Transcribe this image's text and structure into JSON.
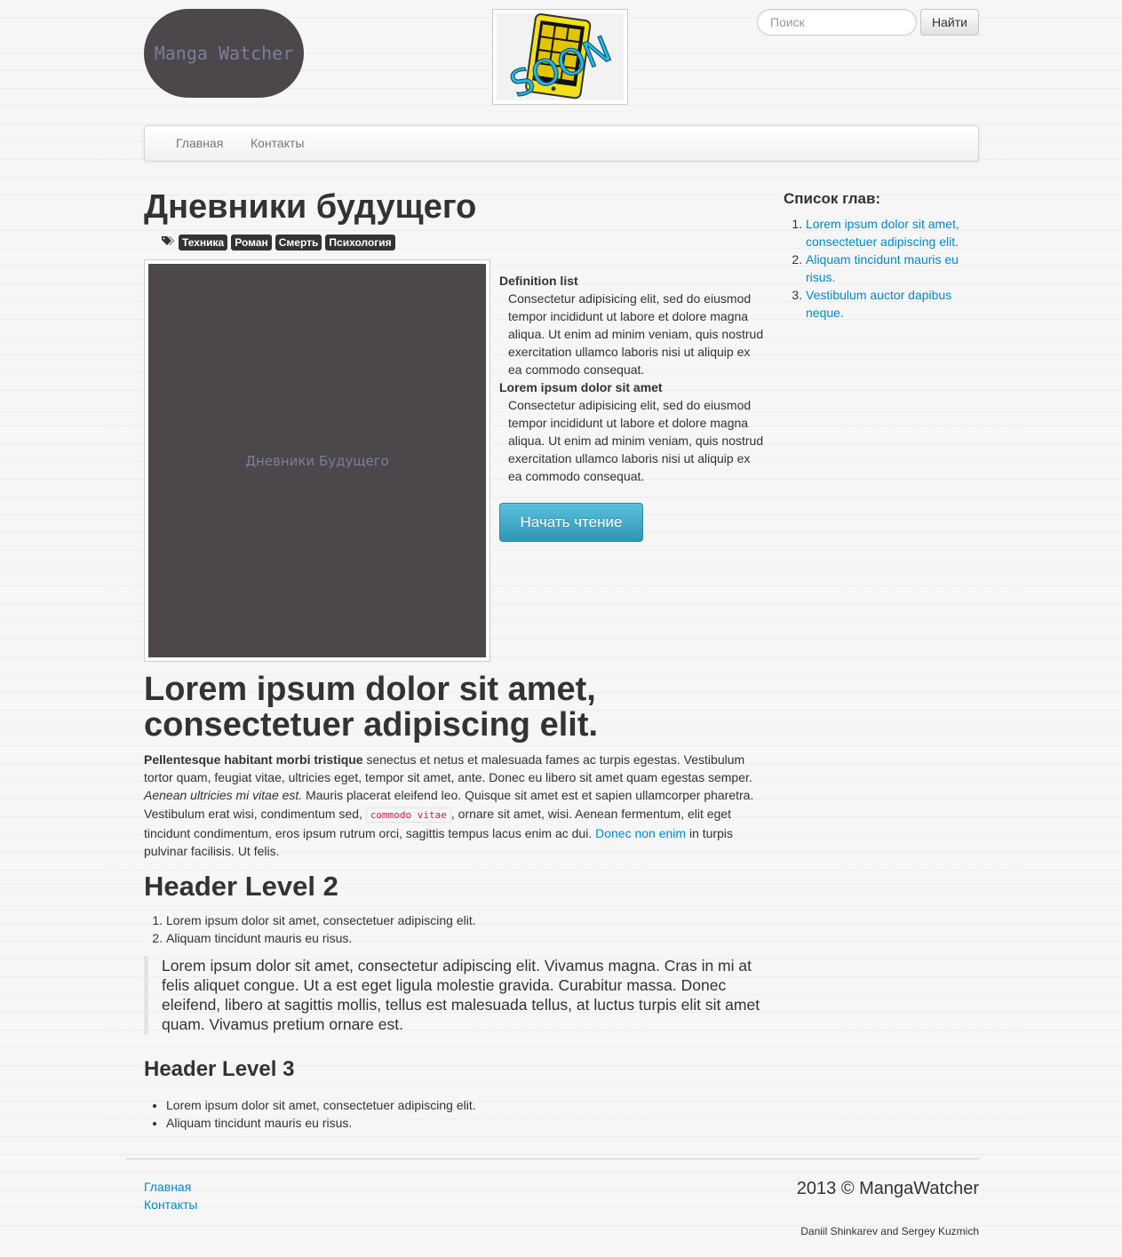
{
  "header": {
    "logo_text": "Manga Watcher",
    "ad_text": "SOON",
    "search": {
      "placeholder": "Поиск",
      "value": "",
      "button_label": "Найти"
    }
  },
  "nav": {
    "items": [
      "Главная",
      "Контакты"
    ]
  },
  "manga": {
    "title": "Дневники будущего",
    "tags": [
      "Техника",
      "Роман",
      "Смерть",
      "Психология"
    ],
    "cover_text": "Дневники Будущего",
    "definitions": [
      {
        "term": "Definition list",
        "description": "Consectetur adipisicing elit, sed do eiusmod tempor incididunt ut labore et dolore magna aliqua. Ut enim ad minim veniam, quis nostrud exercitation ullamco laboris nisi ut aliquip ex ea commodo consequat."
      },
      {
        "term": "Lorem ipsum dolor sit amet",
        "description": "Consectetur adipisicing elit, sed do eiusmod tempor incididunt ut labore et dolore magna aliqua. Ut enim ad minim veniam, quis nostrud exercitation ullamco laboris nisi ut aliquip ex ea commodo consequat."
      }
    ],
    "start_button": "Начать чтение"
  },
  "sidebar": {
    "title": "Список глав:",
    "chapters": [
      "Lorem ipsum dolor sit amet, consectetuer adipiscing elit.",
      "Aliquam tincidunt mauris eu risus.",
      "Vestibulum auctor dapibus neque."
    ]
  },
  "content": {
    "heading": "Lorem ipsum dolor sit amet, consectetuer adipiscing elit.",
    "paragraph": {
      "strong": "Pellentesque habitant morbi tristique",
      "text1": " senectus et netus et malesuada fames ac turpis egestas. Vestibulum tortor quam, feugiat vitae, ultricies eget, tempor sit amet, ante. Donec eu libero sit amet quam egestas semper. ",
      "em": "Aenean ultricies mi vitae est.",
      "text2": " Mauris placerat eleifend leo. Quisque sit amet est et sapien ullamcorper pharetra. Vestibulum erat wisi, condimentum sed, ",
      "code": "commodo vitae",
      "text3": ", ornare sit amet, wisi. Aenean fermentum, elit eget tincidunt condimentum, eros ipsum rutrum orci, sagittis tempus lacus enim ac dui. ",
      "link": "Donec non enim",
      "text4": " in turpis pulvinar facilisis. Ut felis."
    },
    "h2": "Header Level 2",
    "ordered": [
      "Lorem ipsum dolor sit amet, consectetuer adipiscing elit.",
      "Aliquam tincidunt mauris eu risus."
    ],
    "blockquote": "Lorem ipsum dolor sit amet, consectetur adipiscing elit. Vivamus magna. Cras in mi at felis aliquet congue. Ut a est eget ligula molestie gravida. Curabitur massa. Donec eleifend, libero at sagittis mollis, tellus est malesuada tellus, at luctus turpis elit sit amet quam. Vivamus pretium ornare est.",
    "h3": "Header Level 3",
    "unordered": [
      "Lorem ipsum dolor sit amet, consectetuer adipiscing elit.",
      "Aliquam tincidunt mauris eu risus."
    ]
  },
  "footer": {
    "links": [
      "Главная",
      "Контакты"
    ],
    "copyright": "2013 © MangaWatcher",
    "credits": "Daniil Shinkarev and Sergey Kuzmich"
  },
  "colors": {
    "link": "#0088cc",
    "logo_bg": "#4b474b",
    "info_button": "#49afcd",
    "tag_bg": "#333333"
  }
}
